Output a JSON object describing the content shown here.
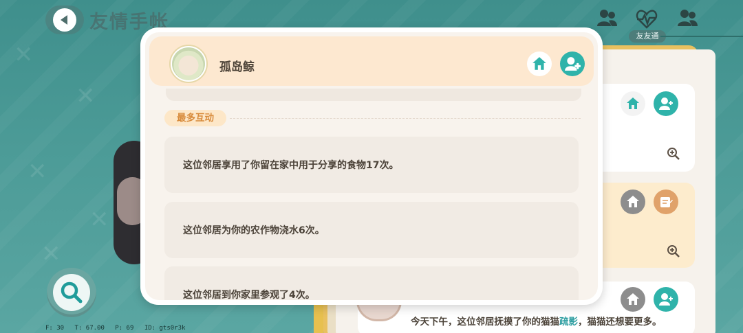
{
  "page": {
    "title": "友情手帐",
    "friend_badge": "友友通",
    "debug": {
      "f": "F: 30",
      "t": "T: 67.00",
      "p": "P: 69",
      "id": "ID: gts0r3k"
    }
  },
  "modal": {
    "friend_name": "孤岛鲸",
    "section_label": "最多互动",
    "interactions": [
      "这位邻居享用了你留在家中用于分享的食物17次。",
      "这位邻居为你的农作物浇水6次。",
      "这位邻居到你家里参观了4次。"
    ]
  },
  "background_list": {
    "bottom_text_before": "今天下午，这位邻居抚摸了你的猫猫",
    "bottom_text_highlight": "疏影",
    "bottom_text_after": "，猫猫还想要更多。"
  },
  "colors": {
    "accent_teal": "#2fb3aa",
    "header_bg": "#fde8d0",
    "tag_text": "#d88b3c"
  },
  "icons": [
    "back-arrow-icon",
    "friends-icon",
    "pulse-heart-icon",
    "home-icon",
    "add-friend-icon",
    "zoom-in-icon",
    "search-icon",
    "note-icon"
  ]
}
